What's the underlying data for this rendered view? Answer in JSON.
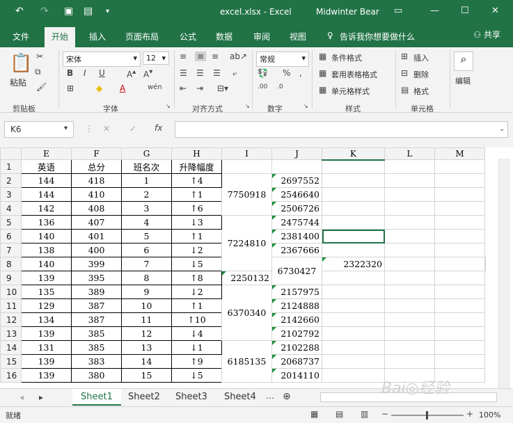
{
  "title_bar": {
    "file_title": "excel.xlsx - Excel",
    "user": "Midwinter Bear"
  },
  "tabs": [
    "文件",
    "开始",
    "插入",
    "页面布局",
    "公式",
    "数据",
    "审阅",
    "视图"
  ],
  "active_tab": "开始",
  "tell_me": "告诉我你想要做什么",
  "share_label": "共享",
  "ribbon": {
    "paste": "粘贴",
    "font_name": "宋体",
    "font_size": "12",
    "number_format": "常规",
    "conditional_format": "条件格式",
    "table_format": "套用表格格式",
    "cell_styles": "单元格样式",
    "insert": "插入",
    "delete": "删除",
    "format": "格式",
    "edit": "编辑",
    "groups": {
      "clipboard": "剪贴板",
      "font": "字体",
      "alignment": "对齐方式",
      "number": "数字",
      "styles": "样式",
      "cells": "单元格"
    }
  },
  "name_box": "K6",
  "fx_label": "fx",
  "columns": [
    "E",
    "F",
    "G",
    "H",
    "I",
    "J",
    "K",
    "L",
    "M"
  ],
  "rows": [
    {
      "n": "1",
      "E": "英语",
      "F": "总分",
      "G": "班名次",
      "H": "升降幅度",
      "J": ""
    },
    {
      "n": "2",
      "E": "144",
      "F": "418",
      "G": "1",
      "H": "↑4",
      "J": "2697552"
    },
    {
      "n": "3",
      "E": "144",
      "F": "410",
      "G": "2",
      "H": "↑1",
      "J": "2546640"
    },
    {
      "n": "4",
      "E": "142",
      "F": "408",
      "G": "3",
      "H": "↑6",
      "J": "2506726"
    },
    {
      "n": "5",
      "E": "136",
      "F": "407",
      "G": "4",
      "H": "↓3",
      "J": "2475744"
    },
    {
      "n": "6",
      "E": "140",
      "F": "401",
      "G": "5",
      "H": "↑1",
      "J": "2381400"
    },
    {
      "n": "7",
      "E": "138",
      "F": "400",
      "G": "6",
      "H": "↓2",
      "J": "2367666"
    },
    {
      "n": "8",
      "E": "140",
      "F": "399",
      "G": "7",
      "H": "↓5",
      "J": "2322320"
    },
    {
      "n": "9",
      "E": "139",
      "F": "395",
      "G": "8",
      "H": "↑8",
      "J": "2250132"
    },
    {
      "n": "10",
      "E": "135",
      "F": "389",
      "G": "9",
      "H": "↓2",
      "J": "2157975"
    },
    {
      "n": "11",
      "E": "129",
      "F": "387",
      "G": "10",
      "H": "↑1",
      "J": "2124888"
    },
    {
      "n": "12",
      "E": "134",
      "F": "387",
      "G": "11",
      "H": "↑10",
      "J": "2142660"
    },
    {
      "n": "13",
      "E": "139",
      "F": "385",
      "G": "12",
      "H": "↓4",
      "J": "2102792"
    },
    {
      "n": "14",
      "E": "131",
      "F": "385",
      "G": "13",
      "H": "↓1",
      "J": "2102288"
    },
    {
      "n": "15",
      "E": "139",
      "F": "383",
      "G": "14",
      "H": "↑9",
      "J": "2068737"
    },
    {
      "n": "16",
      "E": "139",
      "F": "380",
      "G": "15",
      "H": "↓5",
      "J": "2014110"
    }
  ],
  "merged_I": [
    {
      "value": "7750918"
    },
    {
      "value": "7224810"
    },
    {
      "value": "6730427"
    },
    {
      "value": "6370340"
    },
    {
      "value": "6185135"
    }
  ],
  "sheets": [
    "Sheet1",
    "Sheet2",
    "Sheet3",
    "Sheet4"
  ],
  "active_sheet": "Sheet1",
  "status": "就绪",
  "zoom": "100%",
  "colors": {
    "accent": "#217346"
  }
}
